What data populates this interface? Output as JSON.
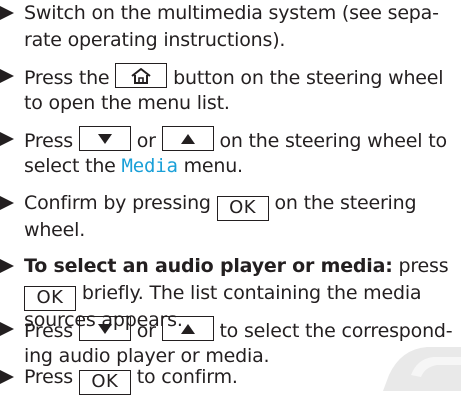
{
  "steps": [
    {
      "lines": [
        [
          "Switch on the multimedia system (see sepa-"
        ],
        [
          "rate operating instructions)."
        ]
      ]
    },
    {
      "line1_pre": "Press the",
      "line1_post": "button on the steering wheel",
      "line2": "to open the menu list."
    },
    {
      "line1_pre": "Press",
      "line1_mid": "or",
      "line1_post": "on the steering wheel to",
      "line2_pre": "select the",
      "line2_media": "Media",
      "line2_post": "menu."
    },
    {
      "line1_pre": "Confirm by pressing",
      "line1_key": "OK",
      "line1_post": "on the steering",
      "line2": "wheel."
    },
    {
      "bold": "To select an audio player or media:",
      "line1_post": "press",
      "line2_key": "OK",
      "line2_post": "briefly. The list containing the media",
      "line3": "sources appears."
    },
    {
      "line1_pre": "Press",
      "line1_mid": "or",
      "line1_post": "to select the correspond-",
      "line2": "ing audio player or media."
    },
    {
      "line1_pre": "Press",
      "line1_key": "OK",
      "line1_post": "to confirm."
    }
  ],
  "icons": {
    "home": "home-icon",
    "down": "down-arrow-icon",
    "up": "up-arrow-icon"
  },
  "colors": {
    "text": "#231f20",
    "media_highlight": "#1aa0d8"
  }
}
